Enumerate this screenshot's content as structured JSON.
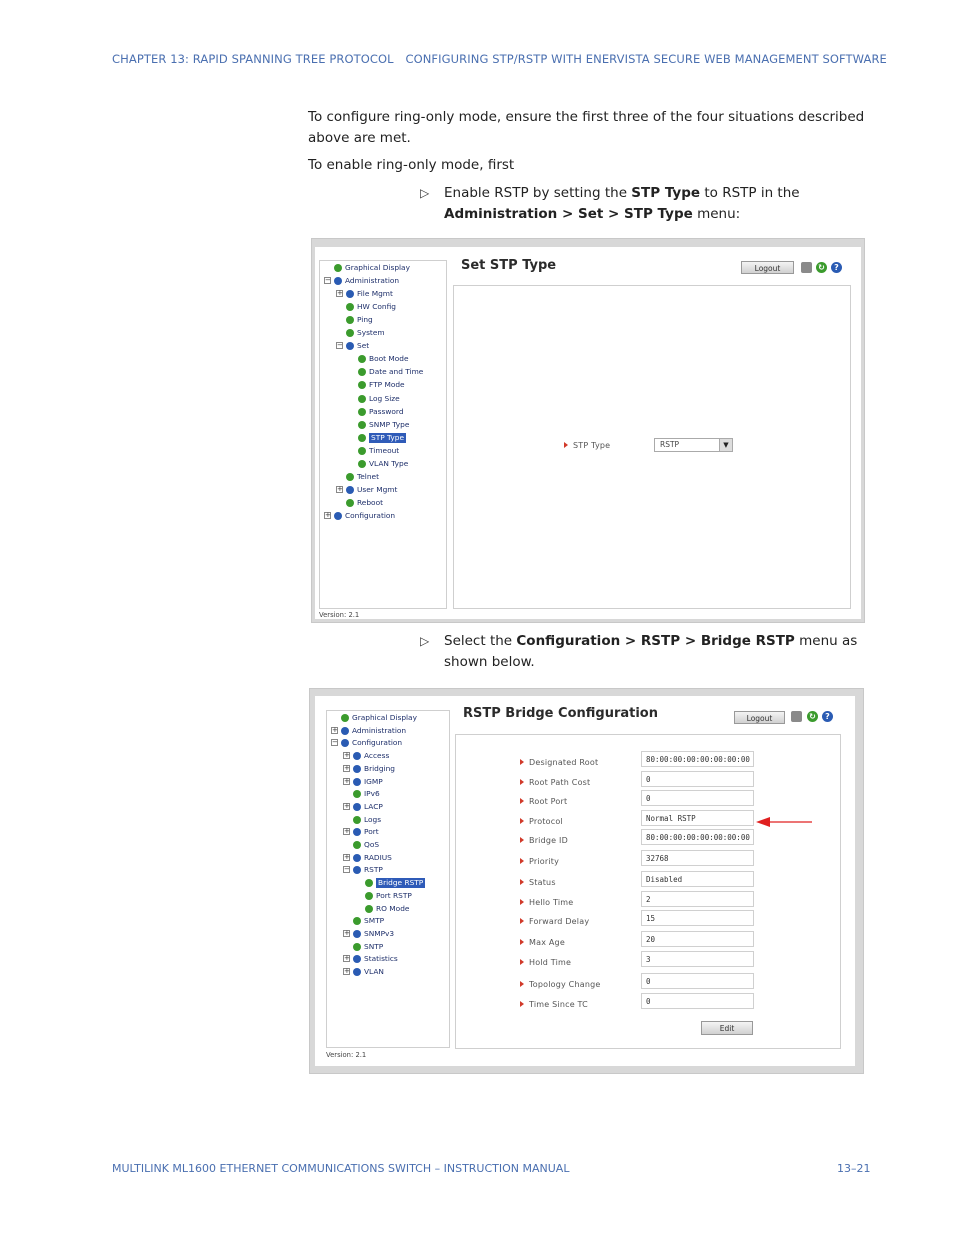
{
  "header": {
    "chapter": "CHAPTER 13: RAPID SPANNING TREE PROTOCOL",
    "section": "CONFIGURING STP/RSTP WITH ENERVISTA SECURE WEB MANAGEMENT SOFTWARE"
  },
  "body": {
    "para1": "To configure ring-only mode, ensure the first three of the four situations described above are met.",
    "para2": "To enable ring-only mode, first",
    "step1": {
      "a": "Enable RSTP by setting the ",
      "b": "STP Type",
      "c": " to RSTP in the ",
      "d": "Administration > Set > STP Type",
      "e": " menu:"
    },
    "step2": {
      "a": "Select the ",
      "b": "Configuration > RSTP > Bridge RSTP",
      "c": " menu as shown below."
    },
    "bullet_icon": "hollow-triangle-icon"
  },
  "shot1": {
    "title": "Set STP Type",
    "logout": "Logout",
    "version": "Version: 2.1",
    "tree": [
      {
        "label": "Graphical Display",
        "icon": "green",
        "pm": ""
      },
      {
        "label": "Administration",
        "icon": "blue",
        "pm": "−"
      },
      {
        "label": "File Mgmt",
        "icon": "blue",
        "pm": "+"
      },
      {
        "label": "HW Config",
        "icon": "green",
        "pm": ""
      },
      {
        "label": "Ping",
        "icon": "green",
        "pm": ""
      },
      {
        "label": "System",
        "icon": "green",
        "pm": ""
      },
      {
        "label": "Set",
        "icon": "blue",
        "pm": "−"
      },
      {
        "label": "Boot Mode",
        "icon": "green",
        "pm": ""
      },
      {
        "label": "Date and Time",
        "icon": "green",
        "pm": ""
      },
      {
        "label": "FTP Mode",
        "icon": "green",
        "pm": ""
      },
      {
        "label": "Log Size",
        "icon": "green",
        "pm": ""
      },
      {
        "label": "Password",
        "icon": "green",
        "pm": ""
      },
      {
        "label": "SNMP Type",
        "icon": "green",
        "pm": ""
      },
      {
        "label": "STP Type",
        "icon": "green",
        "pm": "",
        "selected": true
      },
      {
        "label": "Timeout",
        "icon": "green",
        "pm": ""
      },
      {
        "label": "VLAN Type",
        "icon": "green",
        "pm": ""
      },
      {
        "label": "Telnet",
        "icon": "green",
        "pm": ""
      },
      {
        "label": "User Mgmt",
        "icon": "blue",
        "pm": "+"
      },
      {
        "label": "Reboot",
        "icon": "green",
        "pm": ""
      },
      {
        "label": "Configuration",
        "icon": "blue",
        "pm": "+"
      }
    ],
    "field_label": "STP Type",
    "field_value": "RSTP"
  },
  "shot2": {
    "title": "RSTP Bridge Configuration",
    "logout": "Logout",
    "version": "Version: 2.1",
    "edit": "Edit",
    "tree": [
      {
        "label": "Graphical Display",
        "icon": "green",
        "pm": ""
      },
      {
        "label": "Administration",
        "icon": "blue",
        "pm": "+"
      },
      {
        "label": "Configuration",
        "icon": "blue",
        "pm": "−"
      },
      {
        "label": "Access",
        "icon": "blue",
        "pm": "+"
      },
      {
        "label": "Bridging",
        "icon": "blue",
        "pm": "+"
      },
      {
        "label": "IGMP",
        "icon": "blue",
        "pm": "+"
      },
      {
        "label": "IPv6",
        "icon": "green",
        "pm": ""
      },
      {
        "label": "LACP",
        "icon": "blue",
        "pm": "+"
      },
      {
        "label": "Logs",
        "icon": "green",
        "pm": ""
      },
      {
        "label": "Port",
        "icon": "blue",
        "pm": "+"
      },
      {
        "label": "QoS",
        "icon": "green",
        "pm": ""
      },
      {
        "label": "RADIUS",
        "icon": "blue",
        "pm": "+"
      },
      {
        "label": "RSTP",
        "icon": "blue",
        "pm": "−"
      },
      {
        "label": "Bridge RSTP",
        "icon": "green",
        "pm": "",
        "selected": true
      },
      {
        "label": "Port RSTP",
        "icon": "green",
        "pm": ""
      },
      {
        "label": "RO Mode",
        "icon": "green",
        "pm": ""
      },
      {
        "label": "SMTP",
        "icon": "green",
        "pm": ""
      },
      {
        "label": "SNMPv3",
        "icon": "blue",
        "pm": "+"
      },
      {
        "label": "SNTP",
        "icon": "green",
        "pm": ""
      },
      {
        "label": "Statistics",
        "icon": "blue",
        "pm": "+"
      },
      {
        "label": "VLAN",
        "icon": "blue",
        "pm": "+"
      }
    ],
    "fields": [
      {
        "label": "Designated Root",
        "value": "80:00:00:00:00:00:00:00"
      },
      {
        "label": "Root Path Cost",
        "value": "0"
      },
      {
        "label": "Root Port",
        "value": "0"
      },
      {
        "label": "Protocol",
        "value": "Normal RSTP"
      },
      {
        "label": "Bridge ID",
        "value": "80:00:00:00:00:00:00:00"
      },
      {
        "label": "Priority",
        "value": "32768"
      },
      {
        "label": "Status",
        "value": "Disabled"
      },
      {
        "label": "Hello Time",
        "value": "2"
      },
      {
        "label": "Forward Delay",
        "value": "15"
      },
      {
        "label": "Max Age",
        "value": "20"
      },
      {
        "label": "Hold Time",
        "value": "3"
      },
      {
        "label": "Topology Change",
        "value": "0"
      },
      {
        "label": "Time Since TC",
        "value": "0"
      }
    ],
    "arrow_color": "#e02020"
  },
  "footer": {
    "left": "MULTILINK ML1600 ETHERNET COMMUNICATIONS SWITCH – INSTRUCTION MANUAL",
    "right": "13–21"
  }
}
